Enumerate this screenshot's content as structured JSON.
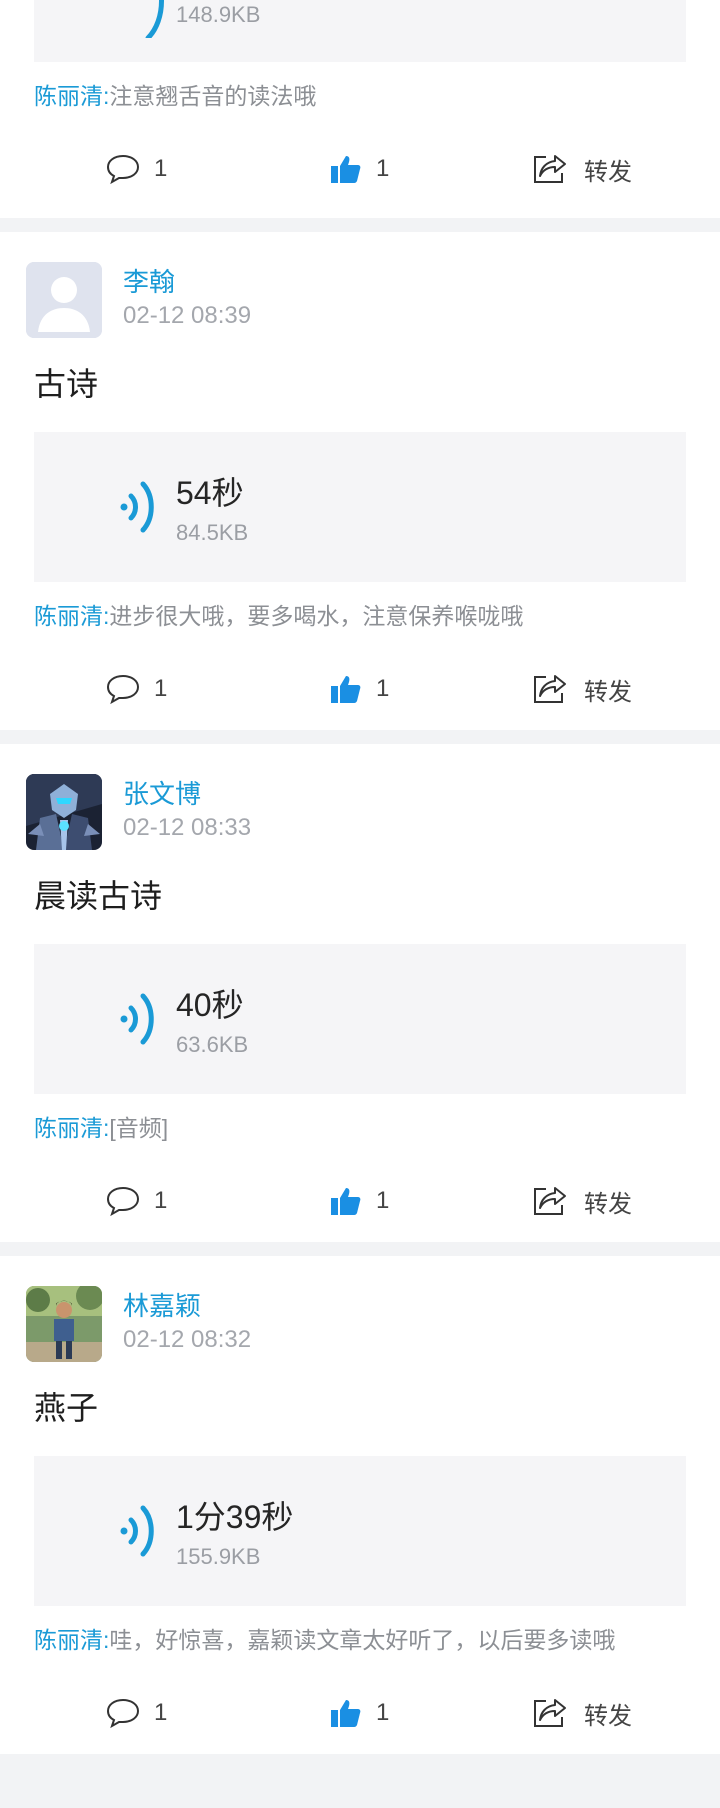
{
  "posts": [
    {
      "partial": true,
      "audio": {
        "size": "148.9KB"
      },
      "comment": {
        "commenter": "陈丽清:",
        "text": "注意翘舌音的读法哦"
      },
      "actions": {
        "reply_count": "1",
        "like_count": "1",
        "share_label": "转发"
      }
    },
    {
      "author": "李翰",
      "time": "02-12 08:39",
      "avatar": "default-avatar",
      "title": "古诗",
      "audio": {
        "duration": "54秒",
        "size": "84.5KB"
      },
      "comment": {
        "commenter": "陈丽清:",
        "text": "进步很大哦，要多喝水，注意保养喉咙哦"
      },
      "actions": {
        "reply_count": "1",
        "like_count": "1",
        "share_label": "转发"
      }
    },
    {
      "author": "张文博",
      "time": "02-12 08:33",
      "avatar": "robot-avatar",
      "title": "晨读古诗",
      "audio": {
        "duration": "40秒",
        "size": "63.6KB"
      },
      "comment": {
        "commenter": "陈丽清:",
        "text": "[音频]"
      },
      "actions": {
        "reply_count": "1",
        "like_count": "1",
        "share_label": "转发"
      }
    },
    {
      "author": "林嘉颖",
      "time": "02-12 08:32",
      "avatar": "child-photo-avatar",
      "title": "燕子",
      "audio": {
        "duration": "1分39秒",
        "size": "155.9KB"
      },
      "comment": {
        "commenter": "陈丽清:",
        "text": "哇，好惊喜，嘉颖读文章太好听了，以后要多读哦"
      },
      "actions": {
        "reply_count": "1",
        "like_count": "1",
        "share_label": "转发"
      }
    }
  ],
  "colors": {
    "accent": "#1a9ad6",
    "like": "#1a8fe3",
    "background": "#f2f3f5"
  }
}
